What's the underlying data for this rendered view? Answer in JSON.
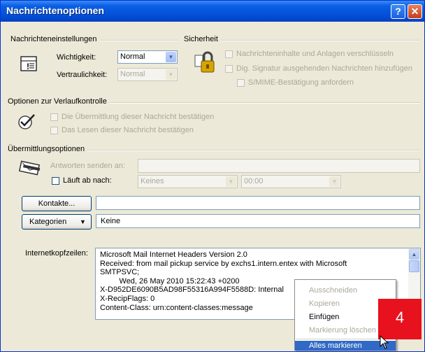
{
  "window": {
    "title": "Nachrichtenoptionen",
    "help": "?",
    "close": "✕"
  },
  "settings": {
    "group_label": "Nachrichteneinstellungen",
    "importance_label": "Wichtigkeit:",
    "importance_value": "Normal",
    "sensitivity_label": "Vertraulichkeit:",
    "sensitivity_value": "Normal"
  },
  "security": {
    "group_label": "Sicherheit",
    "encrypt": "Nachrichteninhalte und Anlagen verschlüsseln",
    "sign": "Dig. Signatur ausgehenden Nachrichten hinzufügen",
    "smime": "S/MIME-Bestätigung anfordern"
  },
  "tracking": {
    "group_label": "Optionen zur Verlaufkontrolle",
    "delivery": "Die Übermittlung dieser Nachricht bestätigen",
    "read": "Das Lesen dieser Nachricht bestätigen"
  },
  "delivery": {
    "group_label": "Übermittlungsoptionen",
    "replies_label": "Antworten senden an:",
    "expires_label": "Läuft ab nach:",
    "expires_date": "Keines",
    "expires_time": "00:00",
    "contacts_button": "Kontakte...",
    "categories_button": "Kategorien",
    "categories_value": "Keine"
  },
  "headers": {
    "label": "Internetkopfzeilen:",
    "lines": [
      "Microsoft Mail Internet Headers Version 2.0",
      "Received: from mail pickup service by exchs1.intern.entex with Microsoft",
      "SMTPSVC;",
      "         Wed, 26 May 2010 15:22:43 +0200",
      "X-D952DE6090B5AD98F55316A994F5588D: Internal",
      "X-RecipFlags: 0",
      "Content-Class: urn:content-classes:message"
    ]
  },
  "context_menu": {
    "items": [
      "Ausschneiden",
      "Kopieren",
      "Einfügen",
      "Markierung löschen",
      "Alles markieren"
    ]
  },
  "annotation": {
    "badge": "4"
  },
  "colors": {
    "titlebar": "#0a5fe4",
    "highlight": "#316ac5",
    "badge": "#e8111e"
  }
}
